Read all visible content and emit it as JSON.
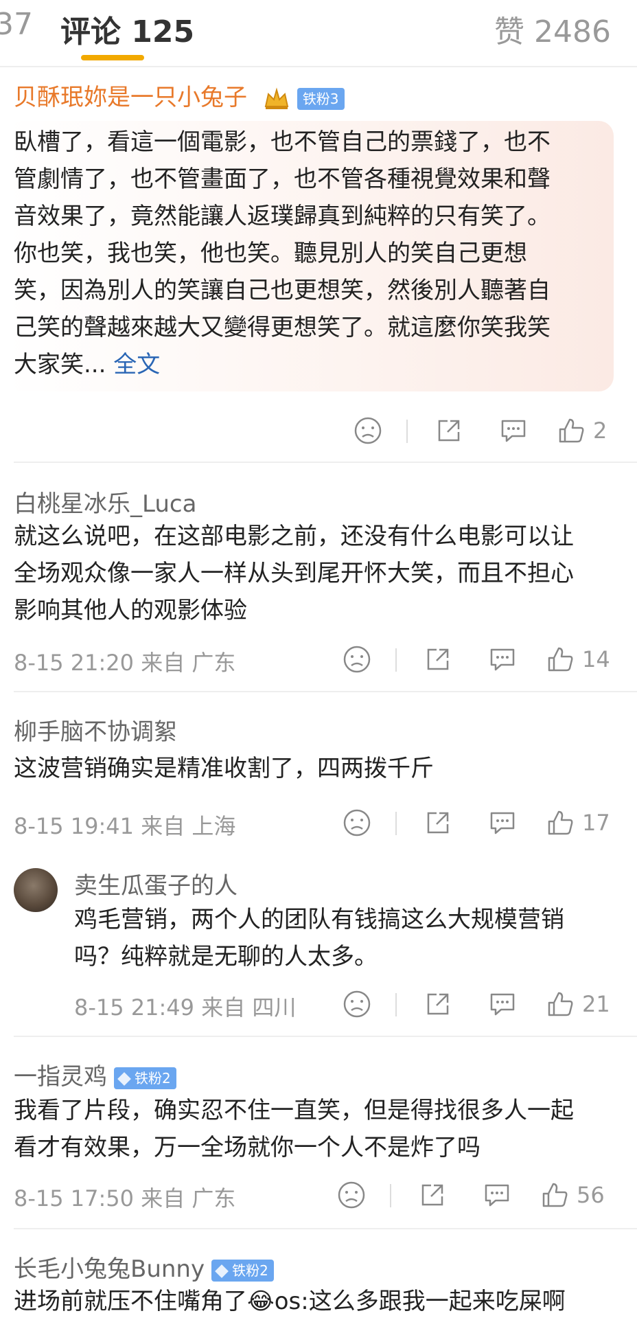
{
  "tabs": {
    "prev_partial": "37",
    "comments": "评论 125",
    "likes": "赞 2486"
  },
  "comments": [
    {
      "name": "贝酥珉妳是一只小兔子",
      "badge": "铁粉3",
      "lines": [
        "臥槽了，看這一個電影，也不管自己的票錢了，也不",
        "管劇情了，也不管畫面了，也不管各種視覺效果和聲",
        "音效果了，竟然能讓人返璞歸真到純粹的只有笑了。",
        "你也笑，我也笑，他也笑。聽見別人的笑自己更想",
        "笑，因為別人的笑讓自己也更想笑，然後別人聽著自",
        "己笑的聲越來越大又變得更想笑了。就這麼你笑我笑",
        "大家笑..."
      ],
      "more": "全文",
      "likes": "2"
    },
    {
      "name": "白桃星冰乐_Luca",
      "lines": [
        "就这么说吧，在这部电影之前，还没有什么电影可以让",
        "全场观众像一家人一样从头到尾开怀大笑，而且不担心",
        "影响其他人的观影体验"
      ],
      "meta": "8-15 21:20  来自 广东",
      "likes": "14"
    },
    {
      "name": "柳手脑不协调絮",
      "lines": [
        "这波营销确实是精准收割了，四两拨千斤"
      ],
      "meta": "8-15 19:41  来自 上海",
      "likes": "17"
    },
    {
      "name": "卖生瓜蛋子的人",
      "lines": [
        "鸡毛营销，两个人的团队有钱搞这么大规模营销",
        "吗？纯粹就是无聊的人太多。"
      ],
      "meta": "8-15 21:49  来自 四川",
      "likes": "21"
    },
    {
      "name": "一指灵鸡",
      "badge": "铁粉2",
      "lines": [
        "我看了片段，确实忍不住一直笑，但是得找很多人一起",
        "看才有效果，万一全场就你一个人不是炸了吗"
      ],
      "meta": "8-15 17:50  来自 广东",
      "likes": "56"
    },
    {
      "name": "长毛小兔兔Bunny",
      "badge": "铁粉2",
      "lines": [
        "进场前就压不住嘴角了😂os:这么多跟我一起来吃屎啊"
      ]
    }
  ],
  "colors": {
    "tab_underline": "#f2a900",
    "vip_name": "#e8792a",
    "link": "#2a66b5",
    "badge": "#6aa6f0"
  }
}
